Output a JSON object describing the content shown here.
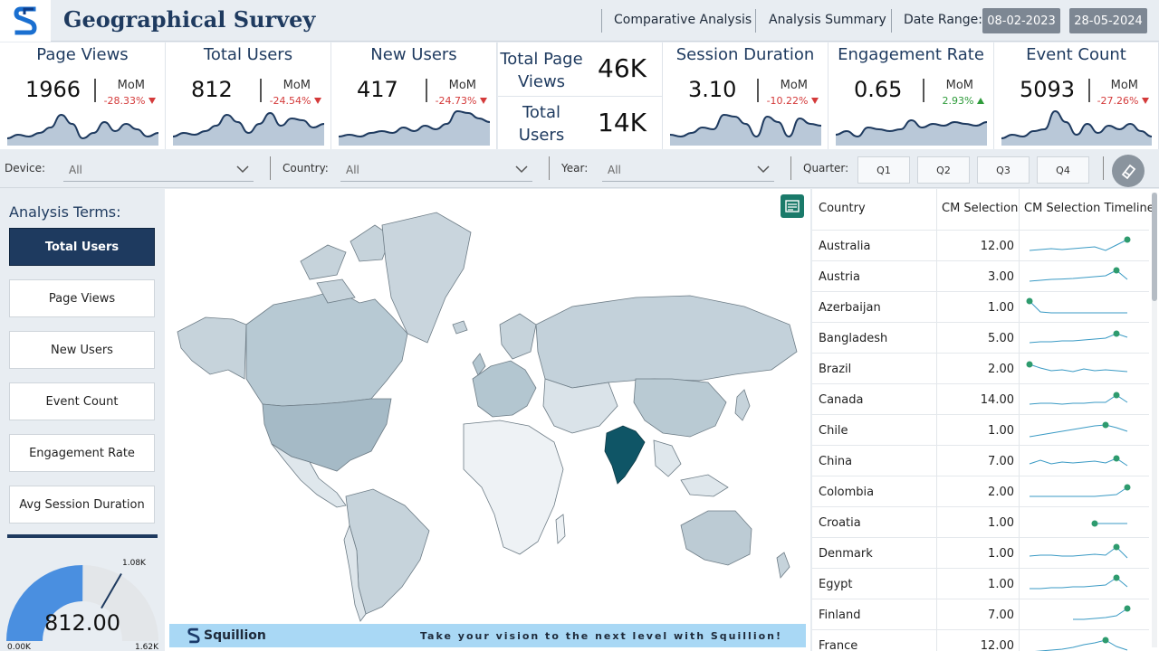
{
  "header": {
    "title": "Geographical Survey",
    "nav": [
      "Comparative Analysis",
      "Analysis Summary"
    ],
    "date_label": "Date Range:",
    "date_start": "08-02-2023",
    "date_end": "28-05-2024"
  },
  "kpis": [
    {
      "title": "Page Views",
      "value": "1966",
      "mom_label": "MoM",
      "pct": "-28.33%",
      "dir": "down",
      "trend": [
        0.15,
        0.25,
        0.2,
        0.3,
        0.45,
        0.8,
        0.55,
        0.15,
        0.3,
        0.6,
        0.35,
        0.55,
        0.4,
        0.2,
        0.3
      ]
    },
    {
      "title": "Total Users",
      "value": "812",
      "mom_label": "MoM",
      "pct": "-24.54%",
      "dir": "down",
      "trend": [
        0.2,
        0.3,
        0.25,
        0.35,
        0.5,
        0.8,
        0.6,
        0.3,
        0.55,
        0.85,
        0.5,
        0.7,
        0.65,
        0.45,
        0.55
      ]
    },
    {
      "title": "New Users",
      "value": "417",
      "mom_label": "MoM",
      "pct": "-24.73%",
      "dir": "down",
      "trend": [
        0.2,
        0.25,
        0.2,
        0.3,
        0.35,
        0.3,
        0.45,
        0.35,
        0.5,
        0.4,
        0.55,
        0.9,
        0.85,
        0.7,
        0.6
      ]
    },
    {
      "title": "Session Duration",
      "value": "3.10",
      "mom_label": "MoM",
      "pct": "-10.22%",
      "dir": "down",
      "trend": [
        0.25,
        0.2,
        0.3,
        0.45,
        0.4,
        0.8,
        0.75,
        0.55,
        0.2,
        0.75,
        0.6,
        0.2,
        0.7,
        0.55,
        0.5
      ]
    },
    {
      "title": "Engagement Rate",
      "value": "0.65",
      "mom_label": "MoM",
      "pct": "2.93%",
      "dir": "up",
      "trend": [
        0.25,
        0.35,
        0.2,
        0.45,
        0.4,
        0.35,
        0.4,
        0.65,
        0.45,
        0.55,
        0.5,
        0.6,
        0.55,
        0.5,
        0.6
      ]
    },
    {
      "title": "Event Count",
      "value": "5093",
      "mom_label": "MoM",
      "pct": "-27.26%",
      "dir": "down",
      "trend": [
        0.15,
        0.25,
        0.2,
        0.35,
        0.4,
        0.9,
        0.6,
        0.25,
        0.55,
        0.3,
        0.5,
        0.4,
        0.55,
        0.35,
        0.2
      ]
    }
  ],
  "totals": {
    "page_views_label": "Total Page Views",
    "page_views_value": "46K",
    "users_label": "Total Users",
    "users_value": "14K"
  },
  "filters": {
    "device_label": "Device:",
    "device_value": "All",
    "country_label": "Country:",
    "country_value": "All",
    "year_label": "Year:",
    "year_value": "All",
    "quarter_label": "Quarter:",
    "quarters": [
      "Q1",
      "Q2",
      "Q3",
      "Q4"
    ]
  },
  "analysis": {
    "title": "Analysis Terms:",
    "terms": [
      "Total Users",
      "Page Views",
      "New Users",
      "Event Count",
      "Engagement Rate",
      "Avg Session Duration"
    ],
    "active": "Total Users"
  },
  "gauge": {
    "value": "812.00",
    "value_num": 812,
    "min": "0.00K",
    "max": "1.62K",
    "max_num": 1620,
    "target": "1.08K",
    "target_num": 1080
  },
  "banner": {
    "brand": "Squillion",
    "tagline": "Take your vision to the next level with Squillion!"
  },
  "table": {
    "headers": [
      "Country",
      "CM Selection",
      "CM Selection Timeline"
    ],
    "rows": [
      {
        "country": "Australia",
        "value": "12.00"
      },
      {
        "country": "Austria",
        "value": "3.00"
      },
      {
        "country": "Azerbaijan",
        "value": "1.00"
      },
      {
        "country": "Bangladesh",
        "value": "5.00"
      },
      {
        "country": "Brazil",
        "value": "2.00"
      },
      {
        "country": "Canada",
        "value": "14.00"
      },
      {
        "country": "Chile",
        "value": "1.00"
      },
      {
        "country": "China",
        "value": "7.00"
      },
      {
        "country": "Colombia",
        "value": "2.00"
      },
      {
        "country": "Croatia",
        "value": "1.00"
      },
      {
        "country": "Denmark",
        "value": "1.00"
      },
      {
        "country": "Egypt",
        "value": "1.00"
      },
      {
        "country": "Finland",
        "value": "7.00"
      },
      {
        "country": "France",
        "value": "12.00"
      }
    ]
  },
  "colors": {
    "navy": "#1e3a5f",
    "spark_fill": "#b9c8d8",
    "spark_line": "#1e3a5f",
    "india": "#0f5566",
    "table_line": "#3a9ac4",
    "table_dot": "#2e9b6e"
  }
}
